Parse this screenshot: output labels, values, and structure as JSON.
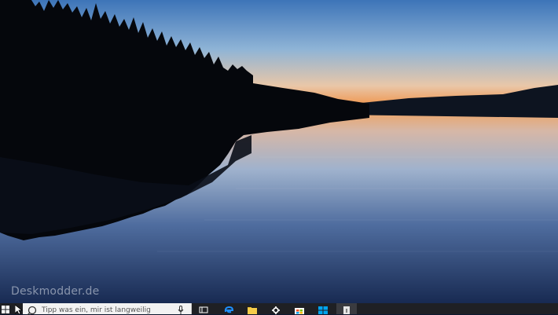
{
  "desktop": {
    "wallpaper": "lake-sunset",
    "watermark": "Deskmodder.de"
  },
  "taskbar": {
    "search_placeholder": "Tipp was ein, mir ist langweilig",
    "icons": [
      "windows-start-icon",
      "search-icon",
      "microphone-icon",
      "task-view-icon",
      "edge-icon",
      "file-explorer-icon",
      "settings-icon",
      "store-icon",
      "windows-icon",
      "app-icon"
    ],
    "colors": {
      "taskbar": "#1f2024",
      "search_bg": "#f2f2f2",
      "accent": "#0078d7"
    }
  }
}
